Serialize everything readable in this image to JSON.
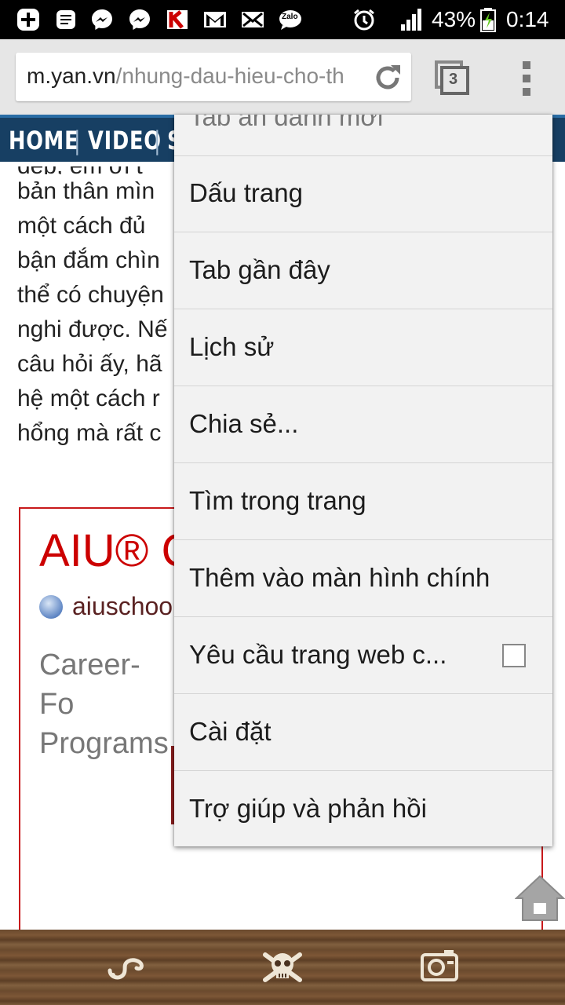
{
  "status_bar": {
    "battery": "43%",
    "time": "0:14",
    "icons": [
      "plus-icon",
      "notes-icon",
      "messenger-icon",
      "messenger-icon",
      "kaspersky-icon",
      "gmail-icon",
      "mail-icon",
      "zalo-icon",
      "alarm-icon",
      "signal-icon",
      "battery-charging-icon"
    ],
    "zalo_label": "Zalo"
  },
  "browser": {
    "url_domain": "m.yan.vn",
    "url_path": "/nhung-dau-hieu-cho-th",
    "tab_count": "3"
  },
  "site_nav": {
    "items": [
      "HOME",
      "VIDEO",
      "S"
    ],
    "separator": "|"
  },
  "article": {
    "lines": [
      "đẹp, em ơi t",
      "bản thân mìn",
      "một cách đủ ",
      "bận đắm chìn",
      "thể có chuyện",
      "nghi được. Nế",
      "câu hỏi ấy, hã",
      "hệ một cách r",
      "hổng mà rất c"
    ]
  },
  "ad": {
    "title": "AIU® C",
    "url": "aiuschoo",
    "desc_lines": [
      "Career-Fo",
      "Programs"
    ]
  },
  "menu": {
    "partial_item": "Tab ẩn danh mới",
    "items": [
      {
        "label": "Dấu trang"
      },
      {
        "label": "Tab gần đây"
      },
      {
        "label": "Lịch sử"
      },
      {
        "label": "Chia sẻ..."
      },
      {
        "label": "Tìm trong trang"
      },
      {
        "label": "Thêm vào màn hình chính"
      },
      {
        "label": "Yêu cầu trang web c...",
        "checkbox": false
      },
      {
        "label": "Cài đặt"
      },
      {
        "label": "Trợ giúp và phản hồi"
      }
    ]
  },
  "bottom_bar": {
    "icons": [
      "hook-icon",
      "skull-icon",
      "camera-icon"
    ]
  },
  "colors": {
    "nav_bg": "#173f63",
    "ad_border": "#c8191b",
    "menu_bg": "#f2f2f2"
  }
}
